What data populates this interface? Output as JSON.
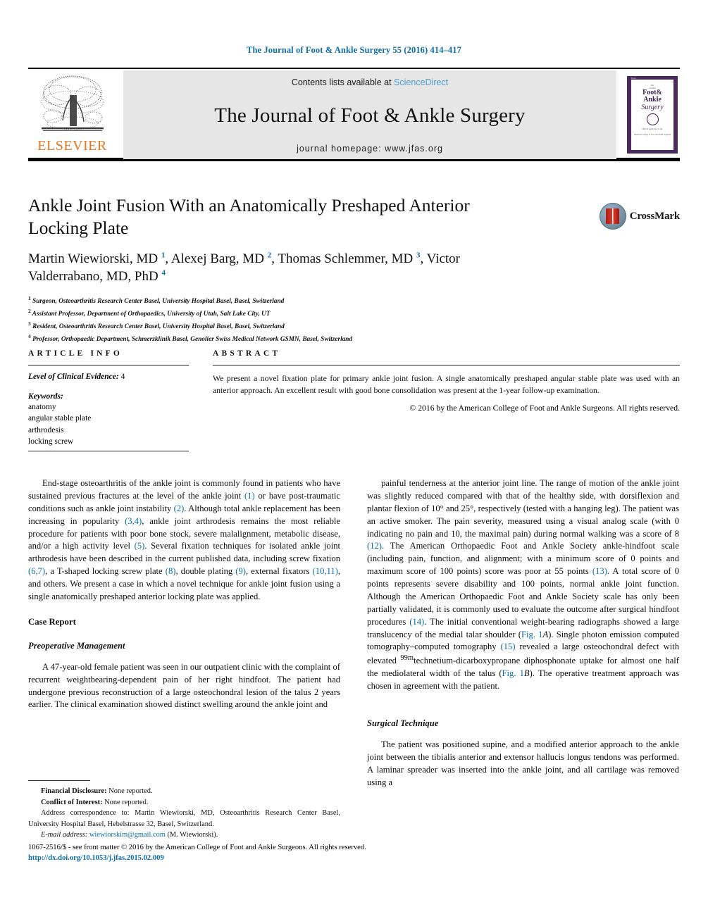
{
  "running_head": "The Journal of Foot & Ankle Surgery 55 (2016) 414–417",
  "masthead": {
    "publisher_logo_word": "ELSEVIER",
    "contents_prefix": "Contents lists available at ",
    "contents_link": "ScienceDirect",
    "journal_name": "The Journal of Foot & Ankle Surgery",
    "homepage": "journal homepage: www.jfas.org",
    "cover": {
      "top_label": "Books",
      "line1": "The",
      "line2": "Journal",
      "line3": "of",
      "big1": "Foot&",
      "big2": "Ankle",
      "script": "Surgery",
      "footer1": "Official publication of the",
      "footer2": "American College of Foot and Ankle Surgeons"
    }
  },
  "crossmark": {
    "label": "CrossMark"
  },
  "title": "Ankle Joint Fusion With an Anatomically Preshaped Anterior Locking Plate",
  "authors_html": "Martin Wiewiorski, MD <sup>1</sup>, Alexej Barg, MD <sup>2</sup>, Thomas Schlemmer, MD <sup>3</sup>, Victor Valderrabano, MD, PhD <sup>4</sup>",
  "affiliations": [
    "Surgeon, Osteoarthritis Research Center Basel, University Hospital Basel, Basel, Switzerland",
    "Assistant Professor, Department of Orthopaedics, University of Utah, Salt Lake City, UT",
    "Resident, Osteoarthritis Research Center Basel, University Hospital Basel, Basel, Switzerland",
    "Professor, Orthopaedic Department, Schmerzklinik Basel, Genolier Swiss Medical Network GSMN, Basel, Switzerland"
  ],
  "article_info": {
    "heading": "ARTICLE INFO",
    "level_label": "Level of Clinical Evidence:",
    "level_value": "4",
    "keywords_label": "Keywords:",
    "keywords": [
      "anatomy",
      "angular stable plate",
      "arthrodesis",
      "locking screw"
    ]
  },
  "abstract": {
    "heading": "ABSTRACT",
    "text": "We present a novel fixation plate for primary ankle joint fusion. A single anatomically preshaped angular stable plate was used with an anterior approach. An excellent result with good bone consolidation was present at the 1-year follow-up examination.",
    "copyright": "© 2016 by the American College of Foot and Ankle Surgeons. All rights reserved."
  },
  "body": {
    "left": {
      "intro_html": "End-stage osteoarthritis of the ankle joint is commonly found in patients who have sustained previous fractures at the level of the ankle joint <span class=\"ref\">(1)</span> or have post-traumatic conditions such as ankle joint instability <span class=\"ref\">(2)</span>. Although total ankle replacement has been increasing in popularity <span class=\"ref\">(3,4)</span>, ankle joint arthrodesis remains the most reliable procedure for patients with poor bone stock, severe malalignment, metabolic disease, and/or a high activity level <span class=\"ref\">(5)</span>. Several fixation techniques for isolated ankle joint arthrodesis have been described in the current published data, including screw fixation <span class=\"ref\">(6,7)</span>, a T-shaped locking screw plate <span class=\"ref\">(8)</span>, double plating <span class=\"ref\">(9)</span>, external fixators <span class=\"ref\">(10,11)</span>, and others. We present a case in which a novel technique for ankle joint fusion using a single anatomically preshaped anterior locking plate was applied.",
      "heading_case_report": "Case Report",
      "heading_preop": "Preoperative Management",
      "preop_html": "A 47-year-old female patient was seen in our outpatient clinic with the complaint of recurrent weightbearing-dependent pain of her right hindfoot. The patient had undergone previous reconstruction of a large osteochondral lesion of the talus 2 years earlier. The clinical examination showed distinct swelling around the ankle joint and"
    },
    "right": {
      "para1_html": "painful tenderness at the anterior joint line. The range of motion of the ankle joint was slightly reduced compared with that of the healthy side, with dorsiflexion and plantar flexion of 10° and 25°, respectively (tested with a hanging leg). The patient was an active smoker. The pain severity, measured using a visual analog scale (with 0 indicating no pain and 10, the maximal pain) during normal walking was a score of 8 <span class=\"ref\">(12)</span>. The American Orthopaedic Foot and Ankle Society ankle-hindfoot scale (including pain, function, and alignment; with a minimum score of 0 points and maximum score of 100 points) score was poor at 55 points <span class=\"ref\">(13)</span>. A total score of 0 points represents severe disability and 100 points, normal ankle joint function. Although the American Orthopaedic Foot and Ankle Society scale has only been partially validated, it is commonly used to evaluate the outcome after surgical hindfoot procedures <span class=\"ref\">(14)</span>. The initial conventional weight-bearing radiographs showed a large translucency of the medial talar shoulder (<span class=\"ref\">Fig. 1</span><i>A</i>). Single photon emission computed tomography–computed tomography <span class=\"ref\">(15)</span> revealed a large osteochondral defect with elevated <sup>99m</sup>technetium-dicarboxypropane diphosphonate uptake for almost one half the mediolateral width of the talus (<span class=\"ref\">Fig. 1</span><i>B</i>). The operative treatment approach was chosen in agreement with the patient.",
      "heading_surgical": "Surgical Technique",
      "para2_html": "The patient was positioned supine, and a modified anterior approach to the ankle joint between the tibialis anterior and extensor hallucis longus tendons was performed. A laminar spreader was inserted into the ankle joint, and all cartilage was removed using a"
    }
  },
  "footnotes": {
    "financial_label": "Financial Disclosure:",
    "financial_text": " None reported.",
    "conflict_label": "Conflict of Interest:",
    "conflict_text": " None reported.",
    "address_label": "Address correspondence to:",
    "address_text": " Martin Wiewiorski, MD, Osteoarthritis Research Center Basel, University Hospital Basel, Hebelstrasse 32, Basel, Switzerland.",
    "email_label": "E-mail address:",
    "email_link": "wiewiorskim@gmail.com",
    "email_suffix": " (M. Wiewiorski)."
  },
  "issn_footer": {
    "line1": "1067-2516/$ - see front matter © 2016 by the American College of Foot and Ankle Surgeons. All rights reserved.",
    "doi": "http://dx.doi.org/10.1053/j.jfas.2015.02.009"
  },
  "colors": {
    "link_blue": "#0b6ea8",
    "sciencedirect_blue": "#4a9fd4",
    "elsevier_orange": "#E87722",
    "cover_purple": "#4b2a5e"
  }
}
